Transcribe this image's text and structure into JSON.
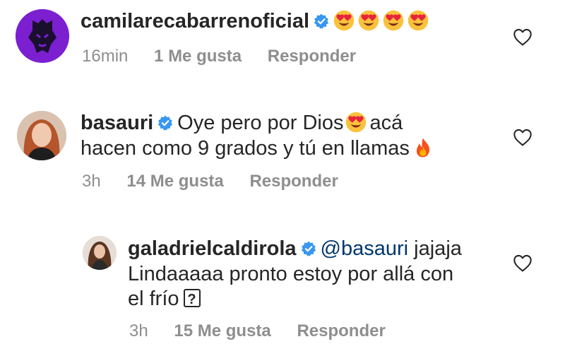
{
  "comments": [
    {
      "username": "camilarecabarrenoficial",
      "text_line1": "",
      "time": "16min",
      "likes": "1 Me gusta",
      "reply_label": "Responder"
    },
    {
      "username": "basauri",
      "text_line1": "Oye pero por Dios",
      "text_line1b": "acá",
      "text_line2": "hacen como 9 grados y tú en llamas",
      "time": "3h",
      "likes": "14 Me gusta",
      "reply_label": "Responder"
    },
    {
      "username": "galadrielcaldirola",
      "mention": "@basauri",
      "text_line1": "jajaja",
      "text_line2": "Lindaaaaa pronto estoy por allá con",
      "text_line3": "el frío",
      "unknown_glyph": "?",
      "time": "3h",
      "likes": "15 Me gusta",
      "reply_label": "Responder"
    }
  ],
  "colors": {
    "text": "#262626",
    "meta": "#8e8e8e",
    "verified": "#3897f0",
    "mention": "#00376b"
  },
  "icons": [
    "verified-badge-icon",
    "heart-eyes-emoji-icon",
    "fire-emoji-icon",
    "heart-outline-icon"
  ]
}
